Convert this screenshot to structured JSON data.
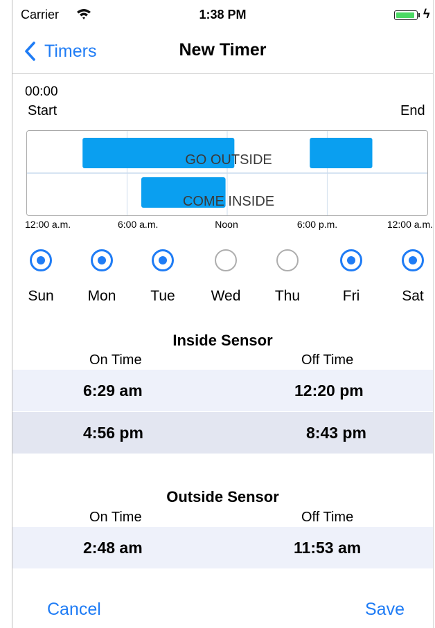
{
  "status_bar": {
    "carrier": "Carrier",
    "time": "1:38 PM",
    "battery_icon": "battery-full-icon",
    "charging_icon": "bolt-icon",
    "wifi_icon": "wifi-icon"
  },
  "nav": {
    "back_label": "Timers",
    "back_icon": "chevron-left-icon",
    "title": "New Timer"
  },
  "timeline": {
    "start_time": "00:00",
    "start_label": "Start",
    "end_label": "End",
    "hour_labels": [
      "12:00 a.m.",
      "6:00 a.m.",
      "Noon",
      "6:00 p.m.",
      "12:00 a.m."
    ],
    "rows": [
      {
        "label": "GO OUTSIDE",
        "intervals": [
          [
            3.33,
            12.43
          ],
          [
            16.95,
            20.7
          ]
        ]
      },
      {
        "label": "COME INSIDE",
        "intervals": [
          [
            6.85,
            11.9
          ]
        ]
      }
    ],
    "bar_color": "#0a9ff0"
  },
  "days": [
    {
      "label": "Sun",
      "selected": true
    },
    {
      "label": "Mon",
      "selected": true
    },
    {
      "label": "Tue",
      "selected": true
    },
    {
      "label": "Wed",
      "selected": false
    },
    {
      "label": "Thu",
      "selected": false
    },
    {
      "label": "Fri",
      "selected": true
    },
    {
      "label": "Sat",
      "selected": true
    }
  ],
  "inside_sensor": {
    "title": "Inside Sensor",
    "on_header": "On Time",
    "off_header": "Off Time",
    "rows": [
      {
        "on": "6:29 am",
        "off": "12:20 pm"
      },
      {
        "on": "4:56 pm",
        "off": "8:43 pm"
      }
    ]
  },
  "outside_sensor": {
    "title": "Outside Sensor",
    "on_header": "On Time",
    "off_header": "Off Time",
    "rows": [
      {
        "on": "2:48 am",
        "off": "11:53 am"
      }
    ]
  },
  "footer": {
    "cancel": "Cancel",
    "save": "Save"
  },
  "colors": {
    "accent": "#1f7cf5",
    "row_light": "#eef1fa",
    "row_dark": "#e3e6f1",
    "radio_off": "#aeaeae"
  }
}
